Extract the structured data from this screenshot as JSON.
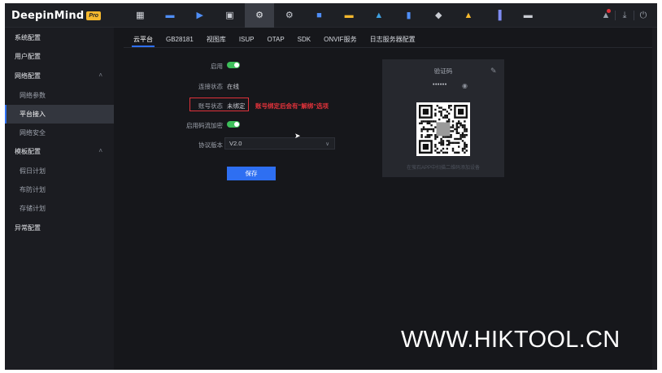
{
  "app": {
    "brand": "DeepinMind",
    "badge": "Pro"
  },
  "modules": [
    {
      "icon": "grid-icon",
      "glyph": "▦",
      "color": "#d8dbe1"
    },
    {
      "icon": "live-view-icon",
      "glyph": "▬",
      "color": "#4f8ef7"
    },
    {
      "icon": "playback-icon",
      "glyph": "▶",
      "color": "#4f8ef7"
    },
    {
      "icon": "file-icon",
      "glyph": "▣",
      "color": "#c9ccd3"
    },
    {
      "icon": "settings-icon",
      "glyph": "⚙",
      "color": "#e8eaee"
    },
    {
      "icon": "maintenance-icon",
      "glyph": "⚙",
      "color": "#c9ccd3"
    },
    {
      "icon": "alarm-icon",
      "glyph": "■",
      "color": "#4f8ef7"
    },
    {
      "icon": "folder-icon",
      "glyph": "▬",
      "color": "#f5b82e"
    },
    {
      "icon": "vehicle-icon",
      "glyph": "▲",
      "color": "#3fa0e0"
    },
    {
      "icon": "building-icon",
      "glyph": "▮",
      "color": "#4f8ef7"
    },
    {
      "icon": "shield-icon",
      "glyph": "◆",
      "color": "#c9ccd3"
    },
    {
      "icon": "people-icon",
      "glyph": "▲",
      "color": "#f5b82e"
    },
    {
      "icon": "statistics-icon",
      "glyph": "▐",
      "color": "#7e8bf2"
    },
    {
      "icon": "keyboard-icon",
      "glyph": "▬",
      "color": "#c9ccd3"
    }
  ],
  "topright": {
    "notify_glyph": "▲",
    "download_glyph": "⤓",
    "power_glyph": "⏻"
  },
  "sidebar": {
    "items": [
      {
        "label": "系统配置",
        "type": "group"
      },
      {
        "label": "用户配置",
        "type": "group"
      },
      {
        "label": "网络配置",
        "type": "group",
        "chevron": "˄"
      },
      {
        "label": "网络参数",
        "type": "sub"
      },
      {
        "label": "平台接入",
        "type": "sub",
        "active": true
      },
      {
        "label": "网络安全",
        "type": "sub"
      },
      {
        "label": "模板配置",
        "type": "group",
        "chevron": "˄"
      },
      {
        "label": "假日计划",
        "type": "sub"
      },
      {
        "label": "布防计划",
        "type": "sub"
      },
      {
        "label": "存储计划",
        "type": "sub"
      },
      {
        "label": "异常配置",
        "type": "group"
      }
    ]
  },
  "tabs": [
    "云平台",
    "GB28181",
    "视图库",
    "ISUP",
    "OTAP",
    "SDK",
    "ONVIF服务",
    "日志服务器配置"
  ],
  "form": {
    "enable_label": "启用",
    "conn_label": "连接状态",
    "conn_value": "在线",
    "account_label": "账号状态",
    "account_value": "未绑定",
    "annotation": "账号绑定后会有“解绑”选项",
    "encrypt_label": "启用码流加密",
    "protocol_label": "协议版本",
    "protocol_value": "V2.0",
    "save_label": "保存"
  },
  "panel": {
    "title": "验证码",
    "password": "••••••",
    "hint": "在萤石APP中扫描二维码添加设备"
  },
  "watermark": "WWW.HIKTOOL.CN"
}
